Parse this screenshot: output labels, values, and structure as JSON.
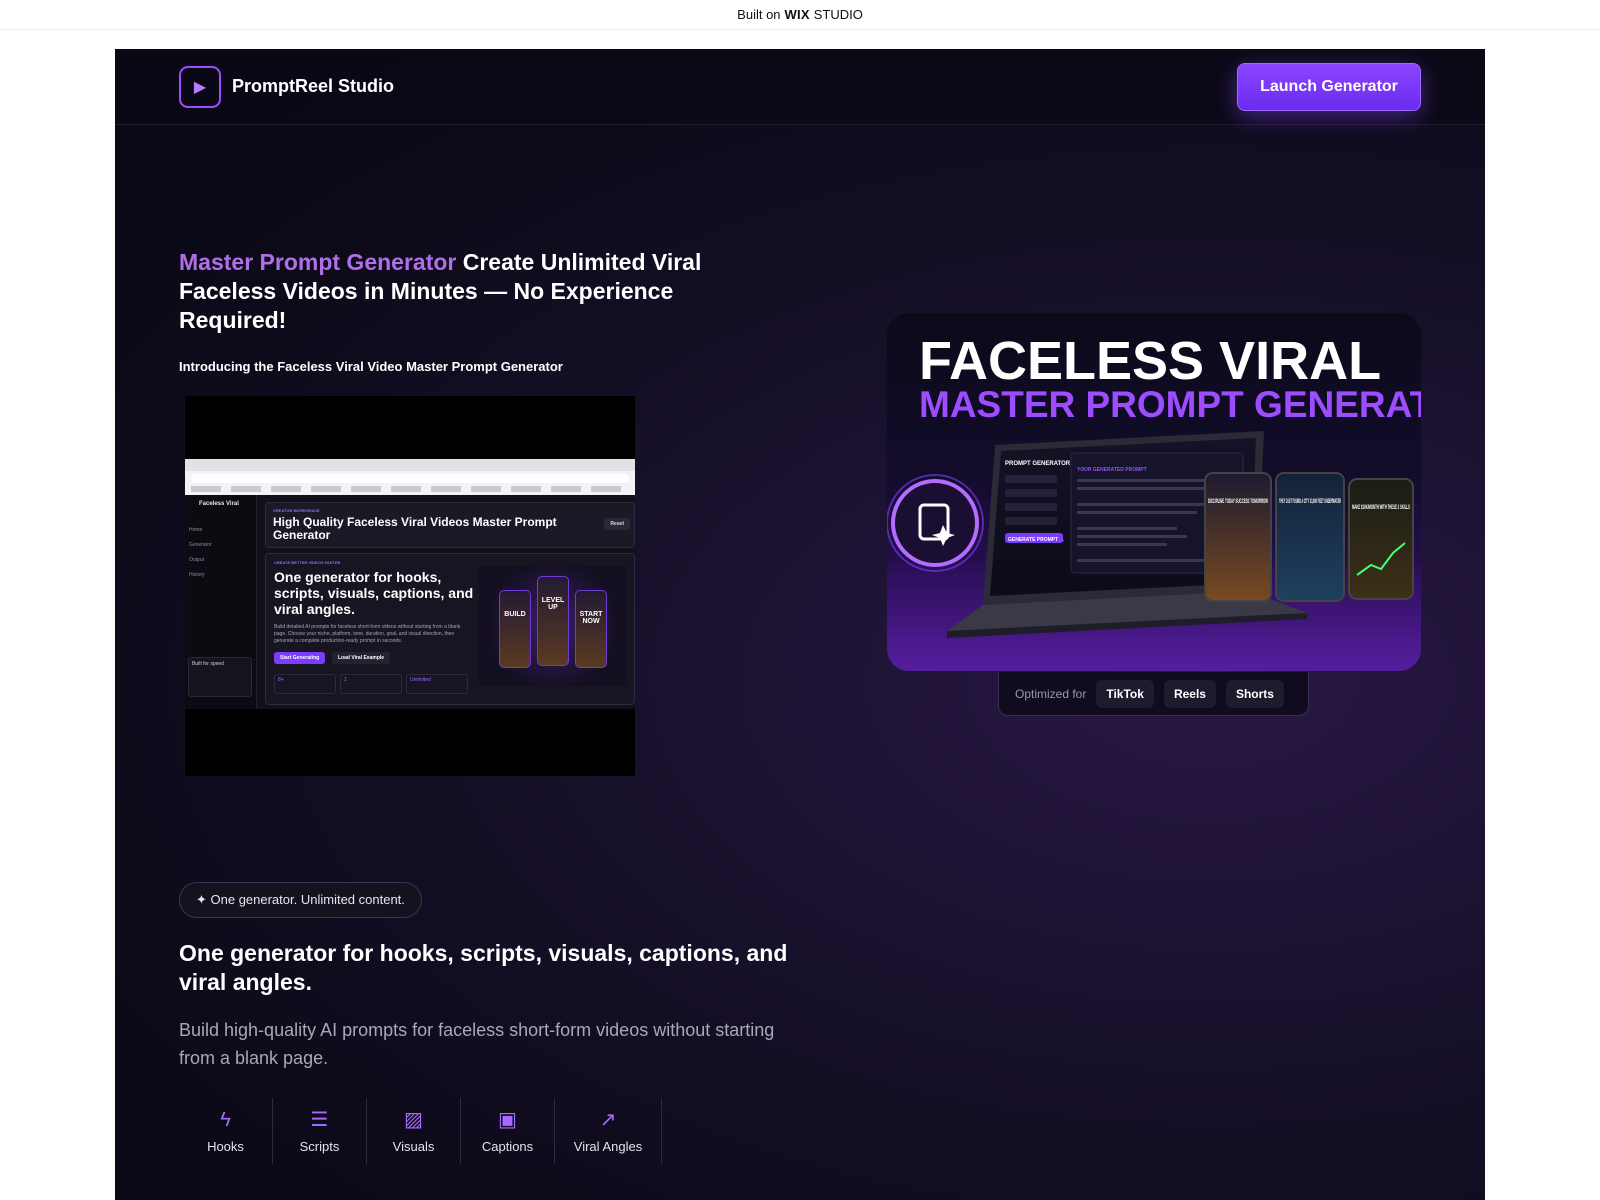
{
  "wix_bar": {
    "prefix": "Built on",
    "brand": "WIX",
    "suffix": "STUDIO"
  },
  "nav": {
    "brand": "PromptReel Studio",
    "cta": "Launch Generator"
  },
  "hero": {
    "title_accent": "Master Prompt Generator",
    "title_rest": "Create Unlimited Viral Faceless Videos in Minutes — No Experience Required!",
    "subtitle": "Introducing the Faceless Viral Video Master Prompt Generator"
  },
  "video": {
    "sidebar_title": "Faceless Viral",
    "sidebar_items": [
      "Home",
      "Generator",
      "Output",
      "History"
    ],
    "speed_title": "Built for speed",
    "header_kicker": "CREATOR WORKSPACE",
    "header_title": "High Quality Faceless Viral Videos Master Prompt Generator",
    "reset_label": "Reset",
    "card_kicker": "CREATE BETTER VIDEOS FASTER",
    "card_title": "One generator for hooks, scripts, visuals, captions, and viral angles.",
    "card_desc": "Build detailed AI prompts for faceless short-form videos without starting from a blank page. Choose your niche, platform, tone, duration, goal, and visual direction, then generate a complete production-ready prompt in seconds.",
    "btn_primary": "Start Generating",
    "btn_secondary": "Load Viral Example",
    "stats": [
      "8+",
      "1",
      "Unlimited"
    ],
    "phone_labels": [
      "BUILD",
      "LEVEL UP",
      "START NOW"
    ]
  },
  "hero_image": {
    "line1": "FACELESS VIRAL",
    "line2": "MASTER PROMPT GENERATOR",
    "laptop_title": "PROMPT GENERATOR",
    "generate_label": "GENERATE PROMPT →",
    "output_label": "YOUR GENERATED PROMPT",
    "phone_captions": [
      "DISCIPLINE TODAY SUCCESS TOMORROW",
      "THEY JUST FOUND A CITY 33,000 FEET UNDERWATER",
      "MAKE $10K/MONTH WITH THESE 3 SKILLS"
    ]
  },
  "optimized": {
    "label": "Optimized for",
    "platforms": [
      "TikTok",
      "Reels",
      "Shorts"
    ]
  },
  "section": {
    "pill": "✦ One generator. Unlimited content.",
    "title": "One generator for hooks, scripts, visuals, captions, and viral angles.",
    "desc": "Build high-quality AI prompts for faceless short-form videos without starting from a blank page."
  },
  "features": [
    {
      "label": "Hooks",
      "icon": "lightning-icon",
      "glyph": "ϟ"
    },
    {
      "label": "Scripts",
      "icon": "lines-icon",
      "glyph": "☰"
    },
    {
      "label": "Visuals",
      "icon": "pattern-icon",
      "glyph": "▨"
    },
    {
      "label": "Captions",
      "icon": "frame-icon",
      "glyph": "▣"
    },
    {
      "label": "Viral Angles",
      "icon": "trend-arrow-icon",
      "glyph": "↗"
    }
  ],
  "colors": {
    "accent": "#8b45ff",
    "title_accent": "#b06fe8",
    "background": "#0d0a19"
  }
}
